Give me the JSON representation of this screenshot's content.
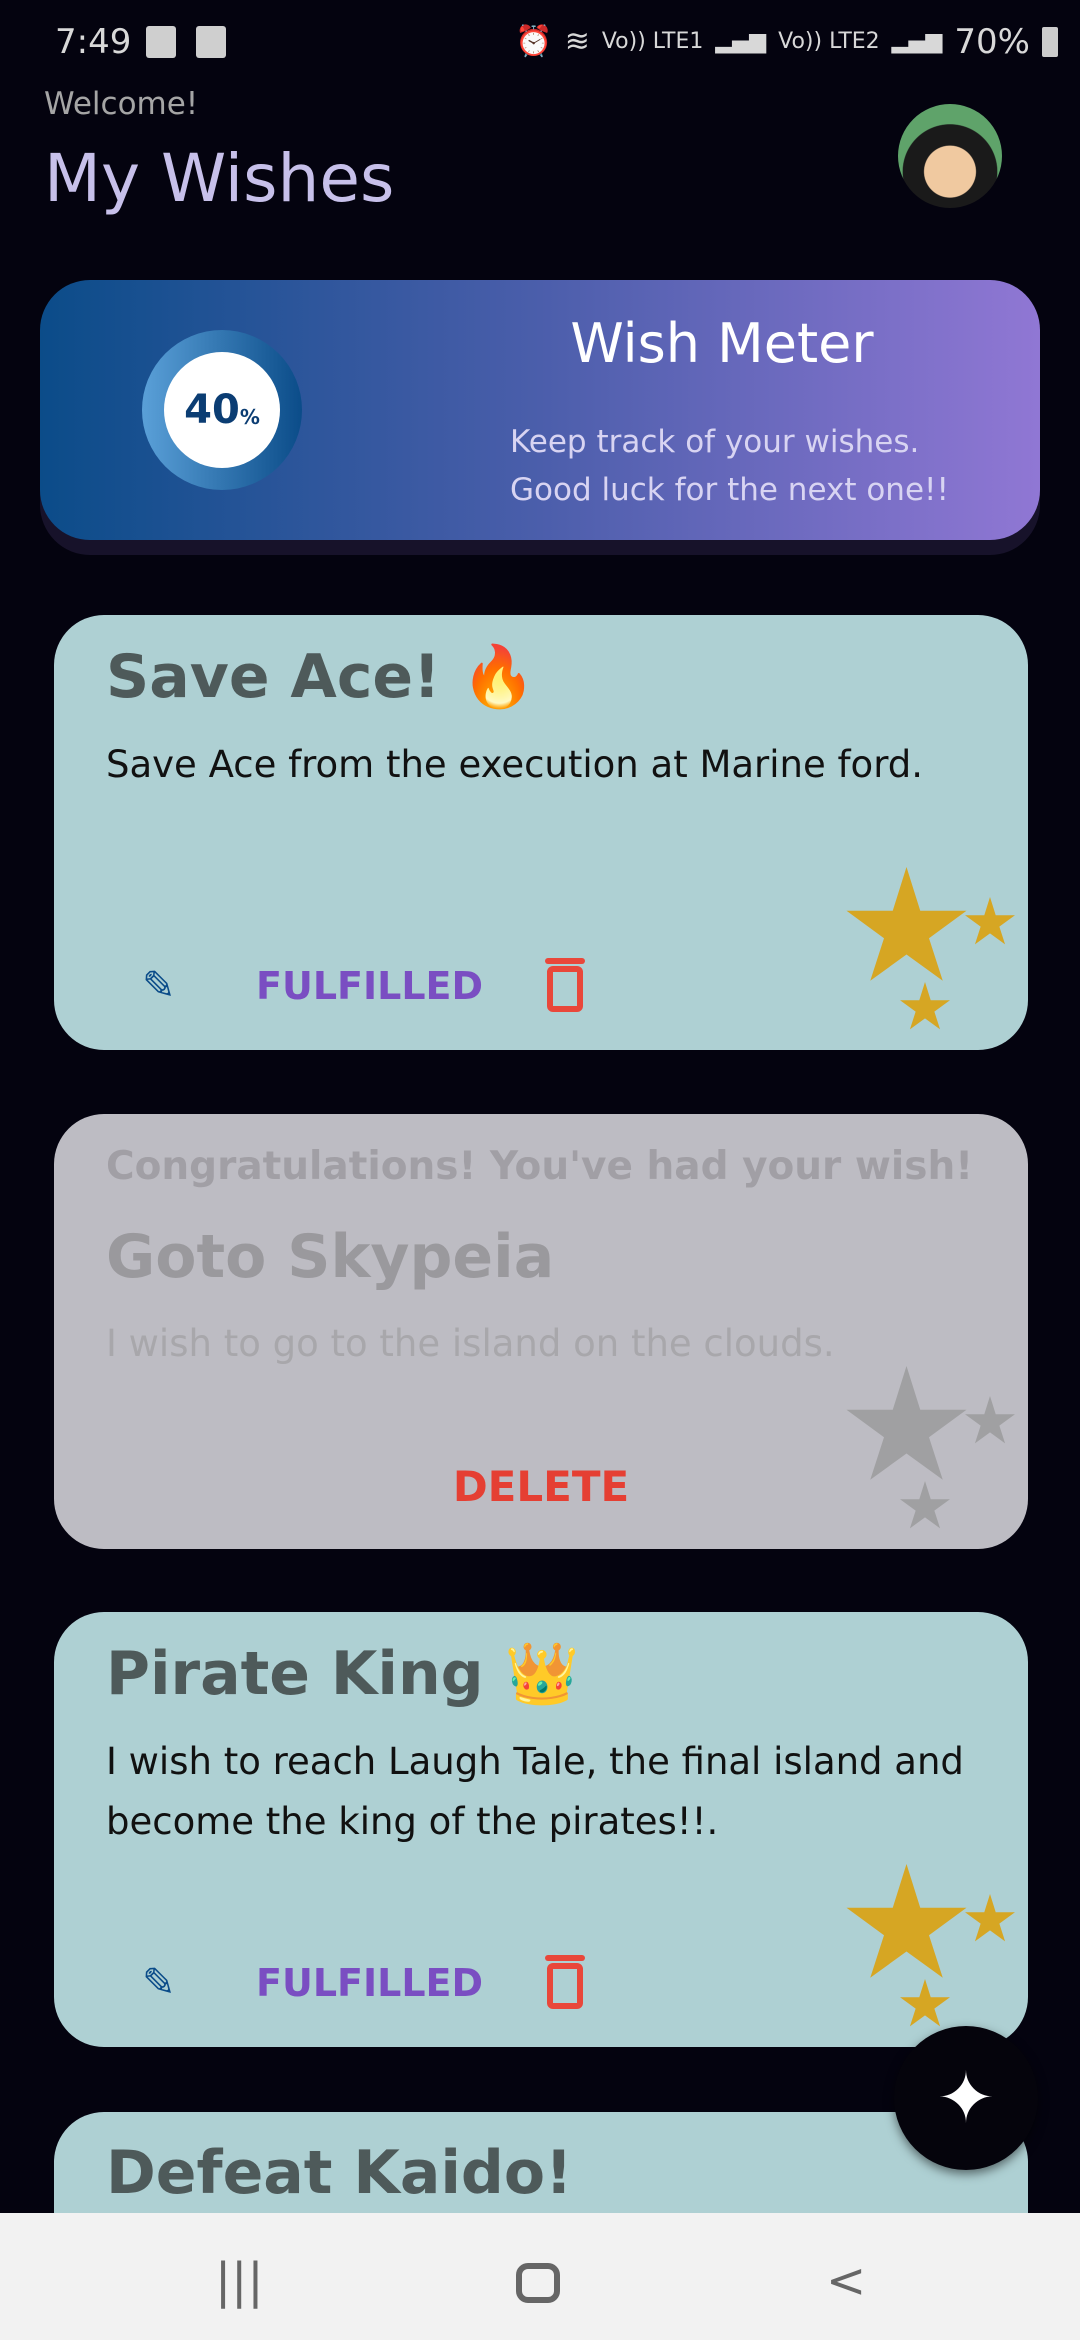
{
  "status_bar": {
    "time": "7:49",
    "network": [
      "Vo)) LTE1",
      "Vo)) LTE2"
    ],
    "battery": "70%"
  },
  "header": {
    "welcome": "Welcome!",
    "title": "My Wishes"
  },
  "wish_meter": {
    "percent": "40",
    "percent_sign": "%",
    "title": "Wish Meter",
    "subtitle_1": "Keep track of your wishes.",
    "subtitle_2": "Good luck for the next one!!",
    "colors": {
      "start": "#0b4c89",
      "end": "#9077d4"
    }
  },
  "wishes": [
    {
      "title": "Save Ace! 🔥",
      "description": "Save Ace from the execution at Marine ford.",
      "fulfill_label": "FULFILLED"
    },
    {
      "congrats": "Congratulations! You've had your wish!",
      "title": "Goto Skypeia",
      "description": "I wish to go to the island on the clouds.",
      "delete_label": "DELETE"
    },
    {
      "title": "Pirate King 👑",
      "description": "I wish to reach Laugh Tale, the final island and become the king of the pirates!!.",
      "fulfill_label": "FULFILLED"
    },
    {
      "title": "Defeat Kaido!"
    }
  ],
  "fab": {
    "icon": "sparkle-icon"
  }
}
